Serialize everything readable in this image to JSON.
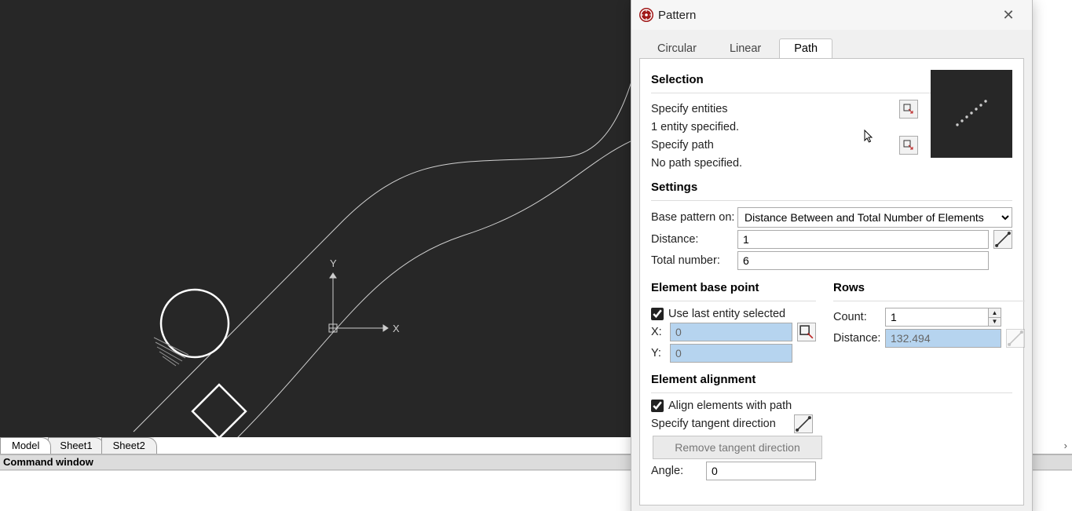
{
  "sheet_tabs": {
    "model": "Model",
    "sheet1": "Sheet1",
    "sheet2": "Sheet2",
    "right_glyph": "›"
  },
  "command_bar": {
    "label": "Command window"
  },
  "axis": {
    "x": "X",
    "y": "Y"
  },
  "dialog": {
    "title": "Pattern",
    "tabs": {
      "circular": "Circular",
      "linear": "Linear",
      "path": "Path"
    },
    "selection": {
      "title": "Selection",
      "specify_entities": "Specify entities",
      "entities_status": "1 entity specified.",
      "specify_path": "Specify path",
      "path_status": "No path specified."
    },
    "settings": {
      "title": "Settings",
      "base_pattern_label": "Base pattern on:",
      "base_pattern_value": "Distance Between and Total Number of Elements",
      "distance_label": "Distance:",
      "distance_value": "1",
      "total_label": "Total number:",
      "total_value": "6"
    },
    "basepoint": {
      "title": "Element base point",
      "use_last": "Use last entity selected",
      "x_label": "X:",
      "x_value": "0",
      "y_label": "Y:",
      "y_value": "0"
    },
    "rows": {
      "title": "Rows",
      "count_label": "Count:",
      "count_value": "1",
      "distance_label": "Distance:",
      "distance_value": "132.494"
    },
    "alignment": {
      "title": "Element alignment",
      "align_with_path": "Align elements with path",
      "tangent_label": "Specify tangent direction",
      "remove_tangent": "Remove tangent direction",
      "angle_label": "Angle:",
      "angle_value": "0"
    }
  }
}
